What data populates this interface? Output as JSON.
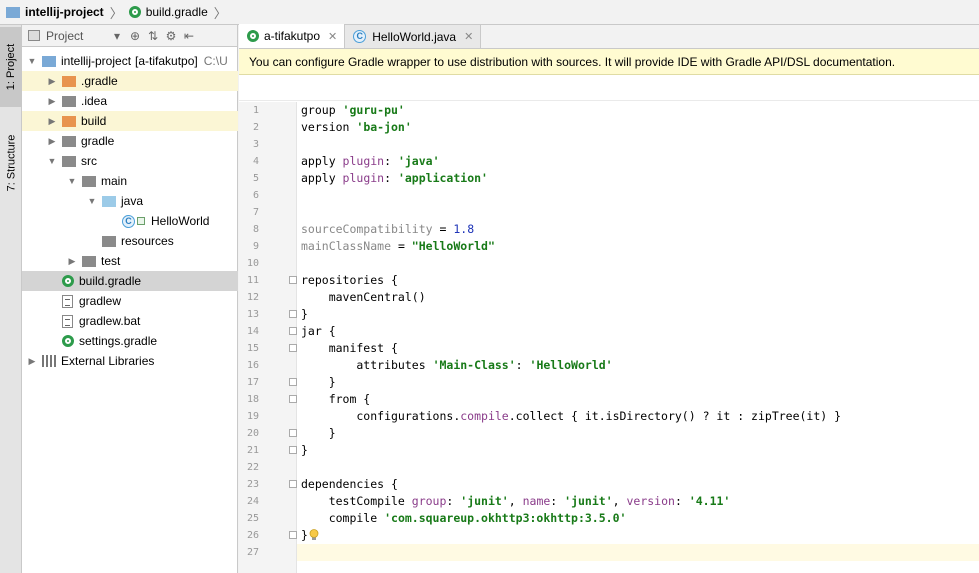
{
  "breadcrumb": {
    "project": "intellij-project",
    "file": "build.gradle"
  },
  "toolstrip": {
    "project_tab": "1: Project",
    "structure_tab": "7: Structure"
  },
  "project_panel": {
    "view_select": "Project",
    "tree": [
      {
        "label": "intellij-project",
        "extra": "[a-tifakutpo]",
        "path": "C:\\U",
        "depth": 0,
        "expanded": true,
        "icon": "folder-blue"
      },
      {
        "label": ".gradle",
        "depth": 1,
        "expanded": false,
        "icon": "folder-orange"
      },
      {
        "label": ".idea",
        "depth": 1,
        "expanded": false,
        "icon": "folder-gray"
      },
      {
        "label": "build",
        "depth": 1,
        "expanded": false,
        "icon": "folder-orange"
      },
      {
        "label": "gradle",
        "depth": 1,
        "expanded": false,
        "icon": "folder-gray"
      },
      {
        "label": "src",
        "depth": 1,
        "expanded": true,
        "icon": "folder-gray"
      },
      {
        "label": "main",
        "depth": 2,
        "expanded": true,
        "icon": "folder-gray"
      },
      {
        "label": "java",
        "depth": 3,
        "expanded": true,
        "icon": "folder-lightblue"
      },
      {
        "label": "HelloWorld",
        "depth": 4,
        "icon": "class-icon"
      },
      {
        "label": "resources",
        "depth": 3,
        "icon": "folder-gray"
      },
      {
        "label": "test",
        "depth": 2,
        "expanded": false,
        "icon": "folder-gray"
      },
      {
        "label": "build.gradle",
        "depth": 1,
        "icon": "gradle-icon",
        "selected": true
      },
      {
        "label": "gradlew",
        "depth": 1,
        "icon": "file-icon"
      },
      {
        "label": "gradlew.bat",
        "depth": 1,
        "icon": "file-icon"
      },
      {
        "label": "settings.gradle",
        "depth": 1,
        "icon": "gradle-icon"
      },
      {
        "label": "External Libraries",
        "depth": 0,
        "expanded": false,
        "icon": "library-icon"
      }
    ]
  },
  "editor": {
    "tabs": [
      {
        "label": "a-tifakutpo",
        "active": true,
        "icon": "gradle-icon"
      },
      {
        "label": "HelloWorld.java",
        "active": false,
        "icon": "class-icon"
      }
    ],
    "banner": "You can configure Gradle wrapper to use distribution with sources. It will provide IDE with Gradle API/DSL documentation.",
    "lines": [
      [
        [
          "plain",
          "group "
        ],
        [
          "s",
          "'guru-pu'"
        ]
      ],
      [
        [
          "plain",
          "version "
        ],
        [
          "s",
          "'ba-jon'"
        ]
      ],
      [],
      [
        [
          "plain",
          "apply "
        ],
        [
          "p",
          "plugin"
        ],
        [
          "plain",
          ": "
        ],
        [
          "s",
          "'java'"
        ]
      ],
      [
        [
          "plain",
          "apply "
        ],
        [
          "p",
          "plugin"
        ],
        [
          "plain",
          ": "
        ],
        [
          "s",
          "'application'"
        ]
      ],
      [],
      [],
      [
        [
          "gr",
          "sourceCompatibility"
        ],
        [
          "plain",
          " = "
        ],
        [
          "n",
          "1.8"
        ]
      ],
      [
        [
          "gr",
          "mainClassName"
        ],
        [
          "plain",
          " = "
        ],
        [
          "s",
          "\"HelloWorld\""
        ]
      ],
      [],
      [
        [
          "plain",
          "repositories {"
        ]
      ],
      [
        [
          "plain",
          "    mavenCentral()"
        ]
      ],
      [
        [
          "plain",
          "}"
        ]
      ],
      [
        [
          "plain",
          "jar {"
        ]
      ],
      [
        [
          "plain",
          "    manifest {"
        ]
      ],
      [
        [
          "plain",
          "        attributes "
        ],
        [
          "s",
          "'Main-Class'"
        ],
        [
          "plain",
          ": "
        ],
        [
          "s",
          "'HelloWorld'"
        ]
      ],
      [
        [
          "plain",
          "    }"
        ]
      ],
      [
        [
          "plain",
          "    from {"
        ]
      ],
      [
        [
          "plain",
          "        configurations."
        ],
        [
          "p",
          "compile"
        ],
        [
          "plain",
          ".collect { it.isDirectory() ? it : zipTree(it) }"
        ]
      ],
      [
        [
          "plain",
          "    }"
        ]
      ],
      [
        [
          "plain",
          "}"
        ]
      ],
      [],
      [
        [
          "plain",
          "dependencies {"
        ]
      ],
      [
        [
          "plain",
          "    testCompile "
        ],
        [
          "p",
          "group"
        ],
        [
          "plain",
          ": "
        ],
        [
          "s",
          "'junit'"
        ],
        [
          "plain",
          ", "
        ],
        [
          "p",
          "name"
        ],
        [
          "plain",
          ": "
        ],
        [
          "s",
          "'junit'"
        ],
        [
          "plain",
          ", "
        ],
        [
          "p",
          "version"
        ],
        [
          "plain",
          ": "
        ],
        [
          "s",
          "'4.11'"
        ]
      ],
      [
        [
          "plain",
          "    compile "
        ],
        [
          "s",
          "'com.squareup.okhttp3:okhttp:3.5.0'"
        ]
      ],
      [
        [
          "plain",
          "}"
        ]
      ],
      []
    ],
    "line_numbers": [
      "1",
      "2",
      "3",
      "4",
      "5",
      "6",
      "7",
      "8",
      "9",
      "10",
      "11",
      "12",
      "13",
      "14",
      "15",
      "16",
      "17",
      "18",
      "19",
      "20",
      "21",
      "22",
      "23",
      "24",
      "25",
      "26",
      "27"
    ],
    "current_line": 27
  }
}
